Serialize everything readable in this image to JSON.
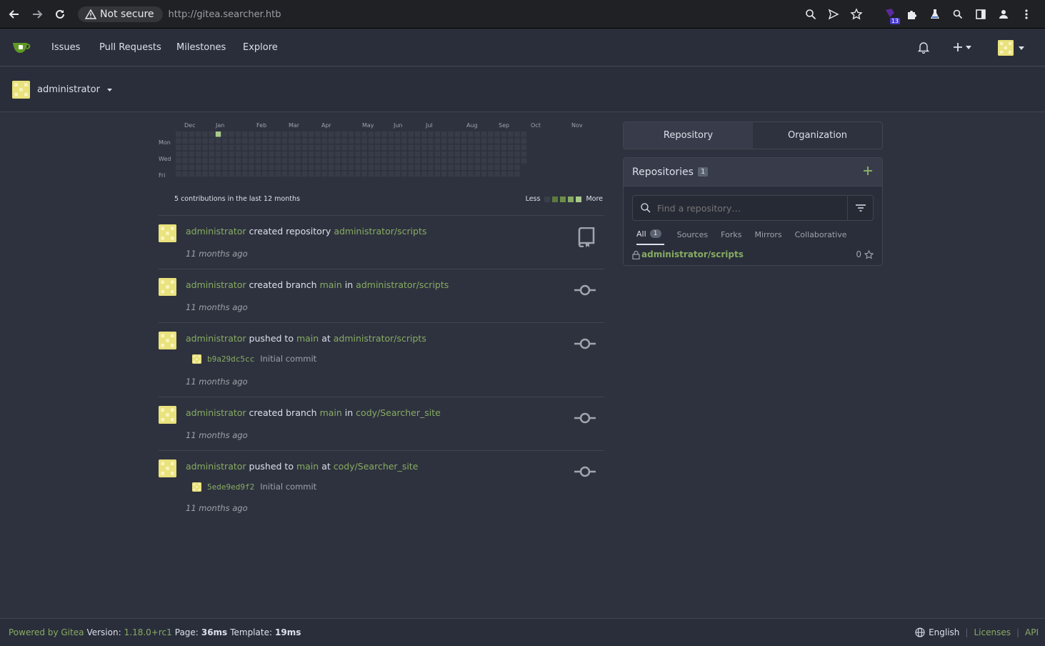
{
  "browser": {
    "security_label": "Not secure",
    "url": "http://gitea.searcher.htb",
    "extension_badge": "13"
  },
  "nav": {
    "issues": "Issues",
    "pull_requests": "Pull Requests",
    "milestones": "Milestones",
    "explore": "Explore"
  },
  "context": {
    "user": "administrator"
  },
  "heatmap": {
    "months": [
      "Dec",
      "Jan",
      "Feb",
      "Mar",
      "Apr",
      "May",
      "Jun",
      "Jul",
      "Aug",
      "Sep",
      "Oct",
      "Nov"
    ],
    "days": [
      "Mon",
      "Wed",
      "Fri"
    ],
    "summary": "5 contributions in the last 12 months",
    "less": "Less",
    "more": "More"
  },
  "feed": [
    {
      "user": "administrator",
      "action": "created repository",
      "repo": "administrator/scripts",
      "time": "11 months ago",
      "icon": "repo-icon"
    },
    {
      "user": "administrator",
      "action": "created branch",
      "branch": "main",
      "prep": "in",
      "repo": "administrator/scripts",
      "time": "11 months ago",
      "icon": "commit-icon"
    },
    {
      "user": "administrator",
      "action": "pushed to",
      "branch": "main",
      "prep": "at",
      "repo": "administrator/scripts",
      "sha": "b9a29dc5cc",
      "message": "Initial commit",
      "time": "11 months ago",
      "icon": "commit-icon"
    },
    {
      "user": "administrator",
      "action": "created branch",
      "branch": "main",
      "prep": "in",
      "repo": "cody/Searcher_site",
      "time": "11 months ago",
      "icon": "commit-icon"
    },
    {
      "user": "administrator",
      "action": "pushed to",
      "branch": "main",
      "prep": "at",
      "repo": "cody/Searcher_site",
      "sha": "5ede9ed9f2",
      "message": "Initial commit",
      "time": "11 months ago",
      "icon": "commit-icon"
    }
  ],
  "panel": {
    "tab_repository": "Repository",
    "tab_organization": "Organization",
    "title": "Repositories",
    "count": "1",
    "search_placeholder": "Find a repository…",
    "subtabs": {
      "all": "All",
      "all_count": "1",
      "sources": "Sources",
      "forks": "Forks",
      "mirrors": "Mirrors",
      "collaborative": "Collaborative"
    },
    "repo_name": "administrator/scripts",
    "repo_stars": "0"
  },
  "footer": {
    "powered": "Powered by Gitea",
    "version_label": "Version:",
    "version": "1.18.0+rc1",
    "page_label": "Page:",
    "page_time": "36ms",
    "template_label": "Template:",
    "template_time": "19ms",
    "language": "English",
    "licenses": "Licenses",
    "api": "API"
  },
  "colors": {
    "accent": "#87ab63",
    "background": "#2e323e",
    "panel": "#2a2e3a"
  }
}
